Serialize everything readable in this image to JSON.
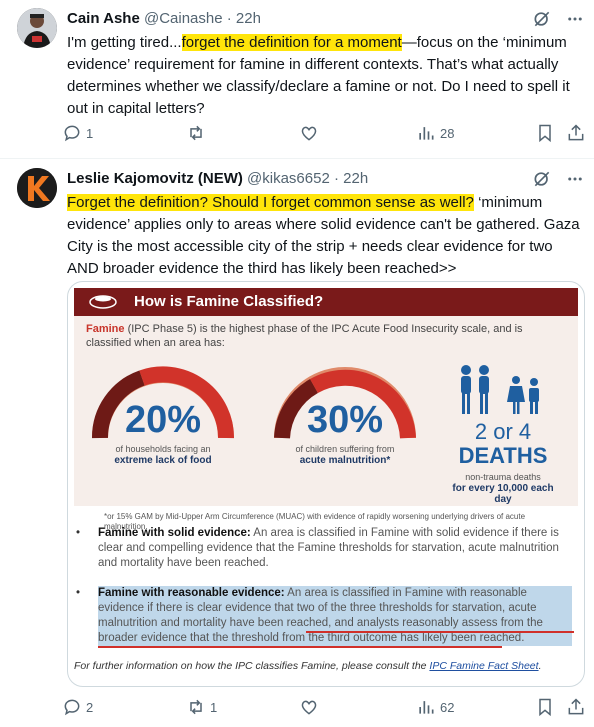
{
  "tweet1": {
    "display_name": "Cain Ashe",
    "handle": "@Cainashe",
    "time": "22h",
    "text_before": "I'm getting tired...",
    "text_highlight": "forget the definition for a moment",
    "text_after": "—focus on the ‘minimum evidence’ requirement for famine in different contexts. That’s what actually determines whether we classify/declare  a famine or not. Do I need to spell it out in capital letters?",
    "replies": "1",
    "reposts": "",
    "likes": "",
    "views": "28"
  },
  "tweet2": {
    "display_name": "Leslie Kajomovitz (NEW)",
    "handle": "@kikas6652",
    "time": "22h",
    "text_highlight": "Forget the definition? Should I forget common sense as well?",
    "text_after": " ‘minimum evidence’ applies only to areas where solid evidence can't be gathered. Gaza City is the most accessible city of the strip + needs clear evidence for two AND broader evidence the third has likely been reached>>",
    "replies": "2",
    "reposts": "1",
    "likes": "",
    "views": "62"
  },
  "infographic": {
    "title": "How is Famine Classified?",
    "intro_lead": "Famine",
    "intro_rest": " (IPC Phase 5) is the highest phase of the IPC Acute Food Insecurity scale, and is classified when an area has:",
    "gauge1": {
      "value": "20%",
      "caption": "of households facing an",
      "caption_bold": "extreme lack of food"
    },
    "gauge2": {
      "value": "30%",
      "caption": "of children suffering from",
      "caption_bold": "acute malnutrition*"
    },
    "deaths": {
      "value": "2 or 4",
      "label": "DEATHS",
      "caption": "non-trauma deaths",
      "caption_bold": "for every 10,000 each day"
    },
    "footnote": "*or 15% GAM by Mid-Upper Arm Circumference (MUAC) with evidence of rapidly worsening underlying drivers of acute malnutrition.",
    "bullet1_lead": "Famine with solid evidence:",
    "bullet1_text": " An area is classified in Famine with solid evidence if there is clear and compelling evidence that the Famine thresholds for starvation, acute malnutrition and mortality have been reached.",
    "bullet2_lead": "Famine with reasonable evidence:",
    "bullet2_text": " An area is classified in Famine with reasonable evidence if there is clear evidence that two of the three thresholds for starvation, acute malnutrition and mortality have been reached, and analysts reasonably assess from the broader evidence that the threshold from the third outcome has likely been reached.",
    "fact_text": "For further information on how the IPC classifies Famine, please consult the ",
    "fact_link": "IPC Famine Fact Sheet",
    "fact_end": "."
  },
  "colors": {
    "highlight": "#ffe50a",
    "banner": "#7a1a1a",
    "gauge_fill": "#d1332a",
    "gauge_dark": "#6e1a16",
    "blue": "#1f5fa0",
    "selection": "#bfd7ea",
    "red_underline": "#d0302a"
  }
}
